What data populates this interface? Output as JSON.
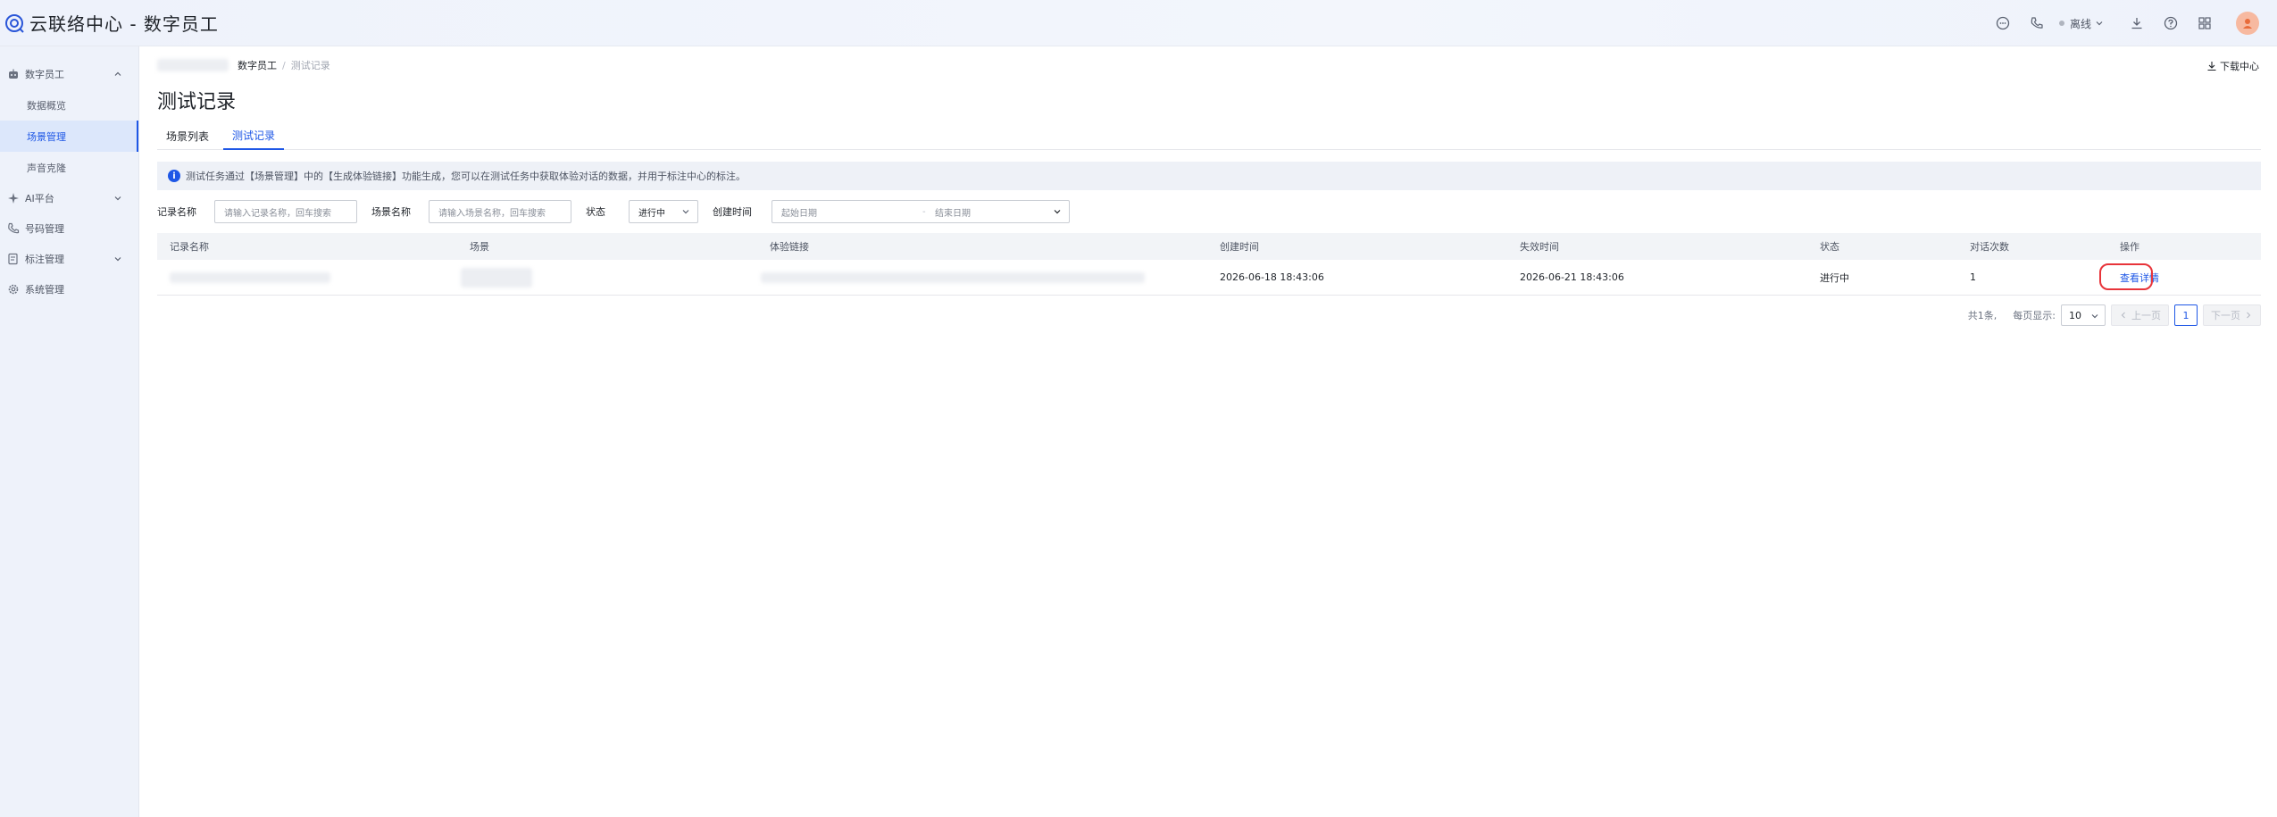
{
  "app": {
    "title": "云联络中心 - 数字员工",
    "agent_status": "离线"
  },
  "sidebar": {
    "groups": [
      {
        "label": "数字员工",
        "items": [
          "数据概览",
          "场景管理",
          "声音克隆"
        ]
      },
      {
        "label": "AI平台"
      },
      {
        "label": "号码管理"
      },
      {
        "label": "标注管理"
      },
      {
        "label": "系统管理"
      }
    ],
    "active_item": "场景管理"
  },
  "breadcrumb": {
    "current": "数字员工",
    "last": "测试记录"
  },
  "download_center": "下载中心",
  "page_title": "测试记录",
  "tabs": [
    {
      "label": "场景列表",
      "active": false
    },
    {
      "label": "测试记录",
      "active": true
    }
  ],
  "notice": "测试任务通过【场景管理】中的【生成体验链接】功能生成，您可以在测试任务中获取体验对话的数据，并用于标注中心的标注。",
  "filters": {
    "record_name_label": "记录名称",
    "record_name_placeholder": "请输入记录名称，回车搜索",
    "scene_name_label": "场景名称",
    "scene_name_placeholder": "请输入场景名称，回车搜索",
    "status_label": "状态",
    "status_value": "进行中",
    "created_label": "创建时间",
    "start_placeholder": "起始日期",
    "range_sep": "-",
    "end_placeholder": "结束日期"
  },
  "table": {
    "columns": [
      "记录名称",
      "场景",
      "体验链接",
      "创建时间",
      "失效时间",
      "状态",
      "对话次数",
      "操作"
    ],
    "rows": [
      {
        "created": "2026-06-18 18:43:06",
        "expires": "2026-06-21 18:43:06",
        "status": "进行中",
        "dialog_count": "1",
        "action": "查看详情"
      }
    ]
  },
  "pagination": {
    "total": "共1条,",
    "page_size_label": "每页显示:",
    "page_size": "10",
    "prev": "上一页",
    "current_page": "1",
    "next": "下一页"
  },
  "colors": {
    "accent": "#1e57e6",
    "highlight": "#e8343a"
  }
}
